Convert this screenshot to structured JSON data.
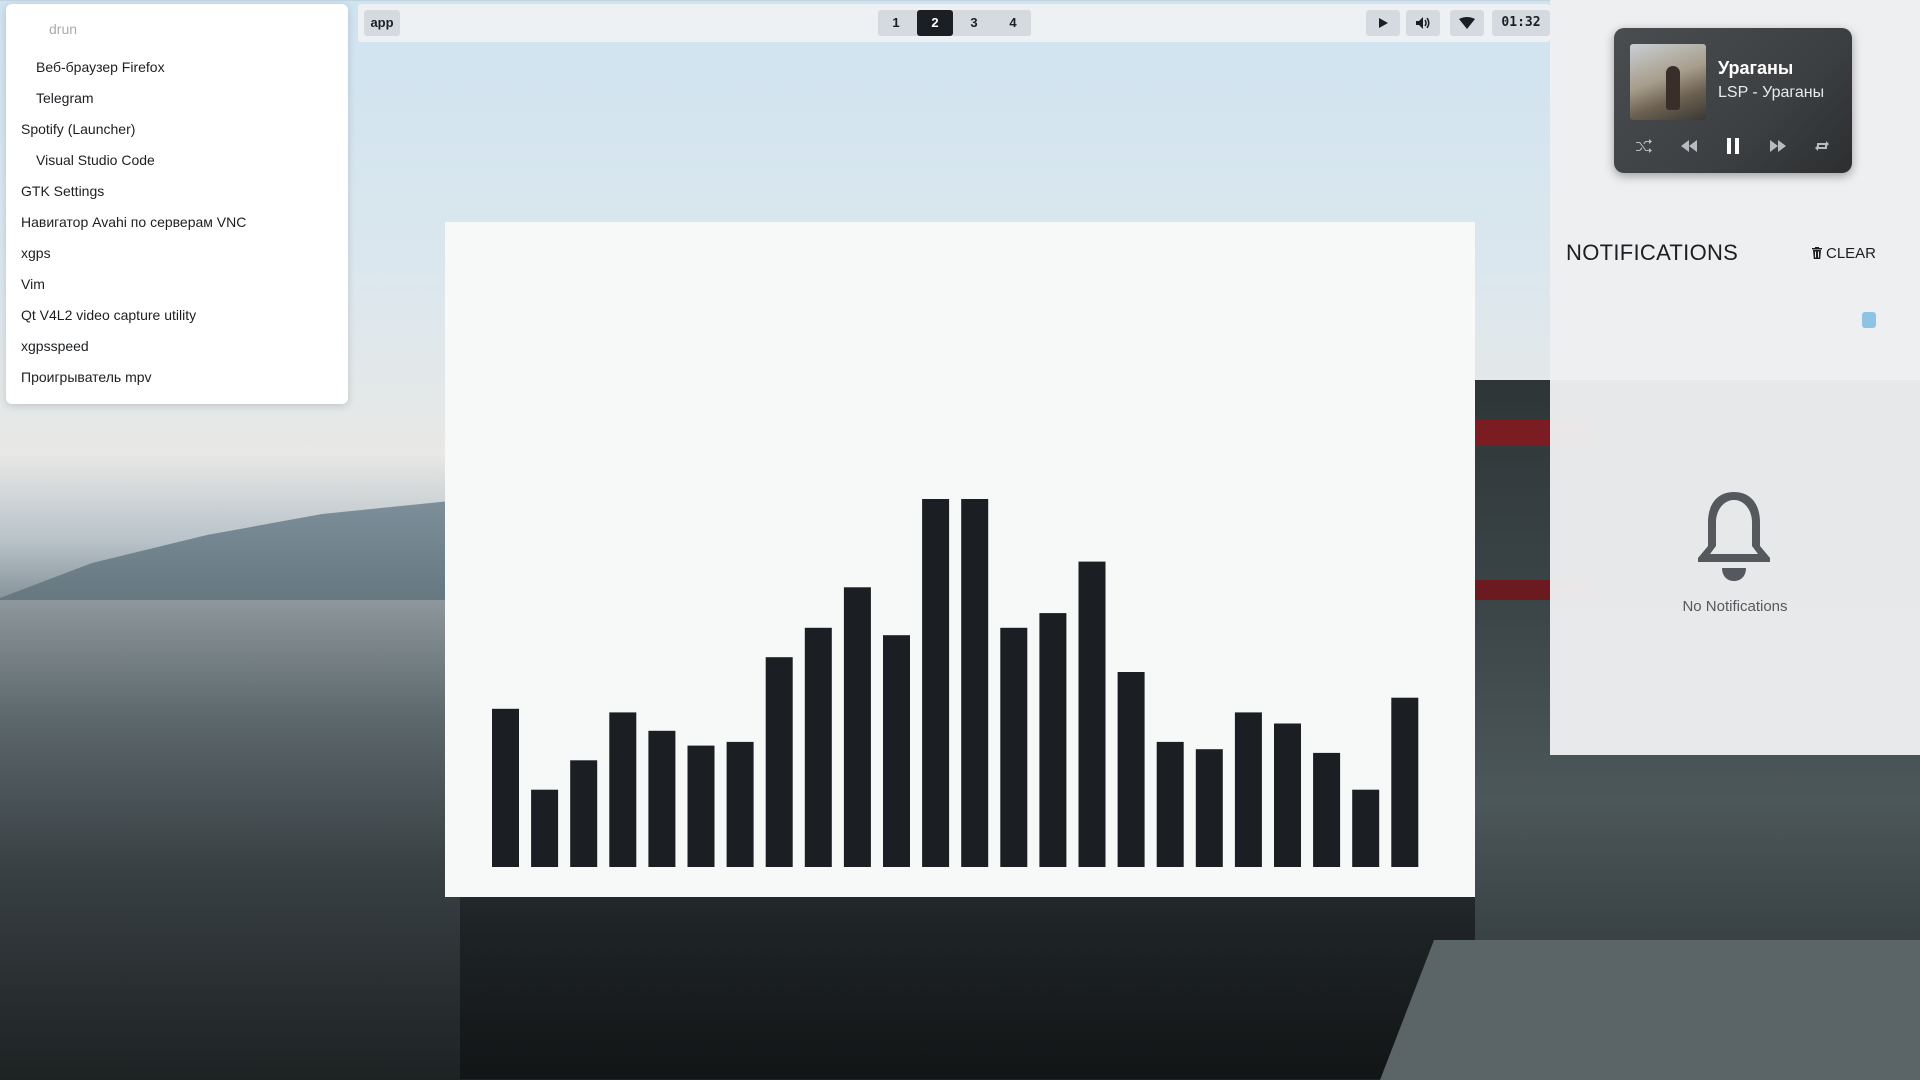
{
  "launcher": {
    "placeholder": "drun",
    "items": [
      {
        "label": "Веб-браузер Firefox",
        "indent": true
      },
      {
        "label": "Telegram",
        "indent": true
      },
      {
        "label": "Spotify (Launcher)",
        "indent": false
      },
      {
        "label": "Visual Studio Code",
        "indent": true
      },
      {
        "label": "GTK Settings",
        "indent": false
      },
      {
        "label": "Навигатор Avahi по серверам VNC",
        "indent": false
      },
      {
        "label": "xgps",
        "indent": false
      },
      {
        "label": "Vim",
        "indent": false
      },
      {
        "label": "Qt V4L2 video capture utility",
        "indent": false
      },
      {
        "label": "xgpsspeed",
        "indent": false
      },
      {
        "label": "Проигрыватель mpv",
        "indent": false
      }
    ]
  },
  "topbar": {
    "app_label": "app",
    "workspaces": [
      "1",
      "2",
      "3",
      "4"
    ],
    "active_workspace": "2",
    "icons": [
      "play-icon",
      "volume-icon",
      "wifi-icon"
    ],
    "clock": "01:32"
  },
  "visualizer": {
    "bar_color": "#1b1f23",
    "levels": [
      43,
      21,
      29,
      42,
      37,
      33,
      34,
      57,
      65,
      76,
      63,
      100,
      100,
      65,
      69,
      83,
      53,
      34,
      32,
      42,
      39,
      31,
      21,
      46
    ]
  },
  "media": {
    "title": "Ураганы",
    "artist": "LSP - Ураганы",
    "controls": [
      "shuffle-icon",
      "previous-icon",
      "pause-icon",
      "next-icon",
      "repeat-icon"
    ]
  },
  "notifications": {
    "title": "NOTIFICATIONS",
    "clear_label": "CLEAR",
    "empty_label": "No Notifications",
    "accent": "#8ec3e6"
  }
}
